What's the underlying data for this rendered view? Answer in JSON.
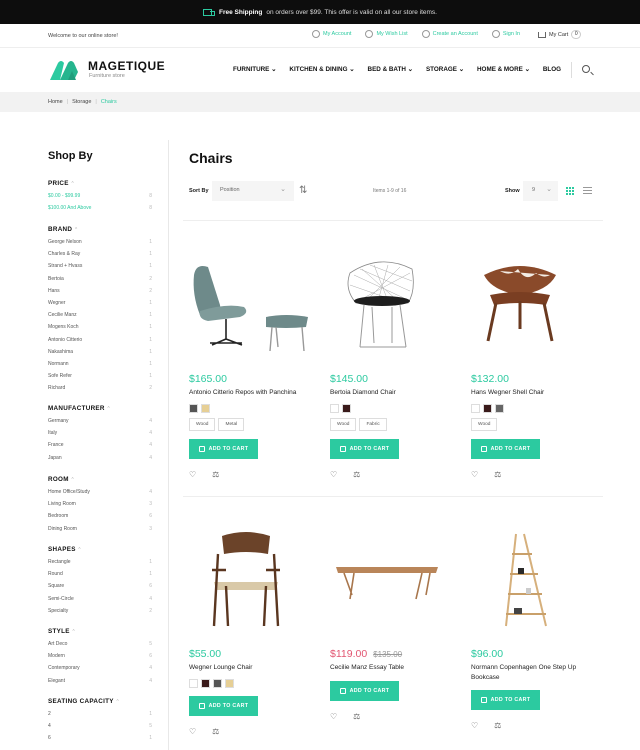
{
  "topbar": {
    "bold": "Free Shipping",
    "rest": "on orders over $99. This offer is valid on all our store items."
  },
  "util": {
    "welcome": "Welcome to our online store!",
    "account": "My Account",
    "wishlist": "My Wish List",
    "create": "Create an Account",
    "signin": "Sign In",
    "cart": "My Cart",
    "cart_count": "0"
  },
  "header": {
    "brand": "MAGETIQUE",
    "tagline": "Furniture store",
    "nav": [
      "FURNITURE",
      "KITCHEN & DINING",
      "BED & BATH",
      "STORAGE",
      "HOME & MORE",
      "BLOG"
    ]
  },
  "breadcrumb": [
    "Home",
    "Storage",
    "Chairs"
  ],
  "sidebar": {
    "title": "Shop By",
    "sections": [
      {
        "title": "PRICE",
        "items": [
          [
            "$0.00 - $99.99",
            "8"
          ],
          [
            "$100.00 And Above",
            "8"
          ]
        ]
      },
      {
        "title": "BRAND",
        "items": [
          [
            "George Nelson",
            "1"
          ],
          [
            "Charles & Ray",
            "1"
          ],
          [
            "Strand + Hvass",
            "1"
          ],
          [
            "Bertoia",
            "2"
          ],
          [
            "Hans",
            "2"
          ],
          [
            "Wegner",
            "1"
          ],
          [
            "Cecilie Manz",
            "1"
          ],
          [
            "Mogens Koch",
            "1"
          ],
          [
            "Antonio Citterio",
            "1"
          ],
          [
            "Nakashima",
            "1"
          ],
          [
            "Normann",
            "1"
          ],
          [
            "Sofe Refer",
            "1"
          ],
          [
            "Richard",
            "2"
          ]
        ]
      },
      {
        "title": "MANUFACTURER",
        "items": [
          [
            "Germany",
            "4"
          ],
          [
            "Italy",
            "4"
          ],
          [
            "France",
            "4"
          ],
          [
            "Japan",
            "4"
          ]
        ]
      },
      {
        "title": "ROOM",
        "items": [
          [
            "Home Office/Study",
            "4"
          ],
          [
            "Living Room",
            "3"
          ],
          [
            "Bedroom",
            "6"
          ],
          [
            "Dining Room",
            "3"
          ]
        ]
      },
      {
        "title": "SHAPES",
        "items": [
          [
            "Rectangle",
            "1"
          ],
          [
            "Round",
            "1"
          ],
          [
            "Square",
            "6"
          ],
          [
            "Semi-Circle",
            "4"
          ],
          [
            "Specialty",
            "2"
          ]
        ]
      },
      {
        "title": "STYLE",
        "items": [
          [
            "Art Deco",
            "5"
          ],
          [
            "Modern",
            "6"
          ],
          [
            "Contemporary",
            "4"
          ],
          [
            "Elegant",
            "4"
          ]
        ]
      },
      {
        "title": "SEATING CAPACITY",
        "items": [
          [
            "2",
            "1"
          ],
          [
            "4",
            "5"
          ],
          [
            "6",
            "1"
          ]
        ]
      }
    ]
  },
  "main": {
    "title": "Chairs",
    "sort_label": "Sort By",
    "sort_value": "Position",
    "items_text": "Items 1-9 of 16",
    "show_label": "Show",
    "show_value": "9"
  },
  "products": [
    {
      "price": "$165.00",
      "name": "Antonio Citterio Repos with Panchina",
      "swatches": [
        "#555555",
        "#e6cf95"
      ],
      "tags": [
        "Wood",
        "Metal"
      ],
      "cta": "ADD TO CART"
    },
    {
      "price": "$145.00",
      "name": "Bertoia Diamond Chair",
      "swatches": [
        "#ffffff",
        "#3a1a1a"
      ],
      "tags": [
        "Wood",
        "Fabric"
      ],
      "cta": "ADD TO CART"
    },
    {
      "price": "$132.00",
      "name": "Hans Wegner Shell Chair",
      "swatches": [
        "#ffffff",
        "#3a1a1a",
        "#666666"
      ],
      "tags": [
        "Wood"
      ],
      "cta": "ADD TO CART"
    },
    {
      "price": "$55.00",
      "name": "Wegner Lounge Chair",
      "swatches": [
        "#ffffff",
        "#3a1a1a",
        "#555555",
        "#e6cf95"
      ],
      "tags": [],
      "cta": "ADD TO CART"
    },
    {
      "price": "$119.00",
      "old_price": "$135.00",
      "name": "Cecilie Manz Essay Table",
      "swatches": [],
      "tags": [],
      "cta": "ADD TO CART",
      "sale": true
    },
    {
      "price": "$96.00",
      "name": "Normann Copenhagen One Step Up Bookcase",
      "swatches": [],
      "tags": [],
      "cta": "ADD TO CART"
    }
  ],
  "colors": {
    "accent": "#2ccaa0",
    "sale": "#e25571",
    "topbar": "#0d0d0d"
  }
}
